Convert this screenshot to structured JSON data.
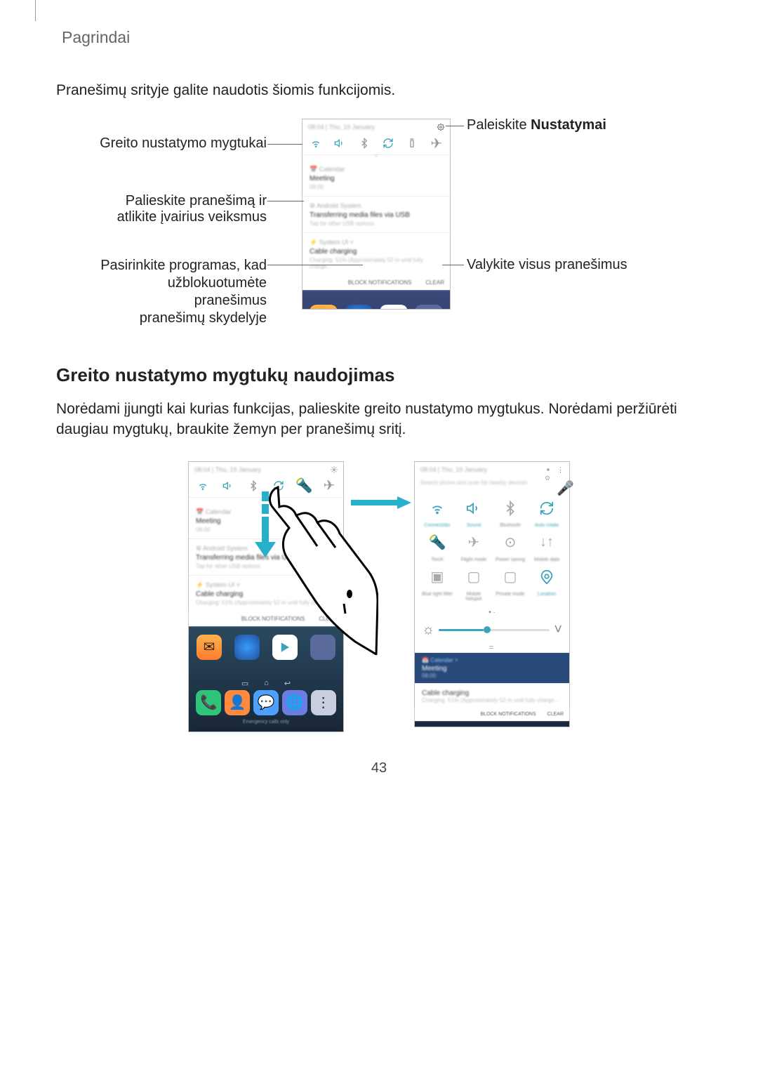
{
  "page": {
    "header": "Pagrindai",
    "number": "43"
  },
  "intro": "Pranešimų srityje galite naudotis šiomis funkcijomis.",
  "section2": {
    "title": "Greito nustatymo mygtukų naudojimas",
    "body": "Norėdami įjungti kai kurias funkcijas, palieskite greito nustatymo mygtukus. Norėdami peržiūrėti daugiau mygtukų, braukite žemyn per pranešimų sritį."
  },
  "callouts": {
    "left1": "Greito nustatymo mygtukai",
    "left2": "Palieskite pranešimą ir atlikite įvairius veiksmus",
    "left3a": "Pasirinkite programas, kad",
    "left3b": "užblokuotumėte pranešimus",
    "left3c": "pranešimų skydelyje",
    "right1_pre": "Paleiskite ",
    "right1_b": "Nustatymai",
    "right2": "Valykite visus pranešimus"
  },
  "phone": {
    "time": "08:04",
    "date": "Thu, 19 January",
    "search_hint": "Search phone and scan for nearby devices",
    "notif_cal_src": "Calendar",
    "notif_cal_title": "Meeting",
    "notif_cal_time": "08:00",
    "notif_sys_src": "Android System",
    "notif_sys_title": "Transferring media files via USB",
    "notif_sys_sub": "Tap for other USB options.",
    "notif_batt_src": "System UI",
    "notif_batt_title": "Cable charging",
    "notif_batt_sub": "Charging: 51% (Approximately 52 m until fully charge...",
    "btn_block": "BLOCK NOTIFICATIONS",
    "btn_clear": "CLEAR",
    "emg": "Emergency calls only",
    "qs_labels": {
      "r1": [
        "Connect/dis",
        "Sound",
        "Bluetooth",
        "Auto rotate"
      ],
      "r2": [
        "Torch",
        "Flight mode",
        "Power saving",
        "Mobile data"
      ],
      "r3": [
        "Blue light filter",
        "Mobile hotspot",
        "Private mode",
        "Location"
      ]
    }
  }
}
